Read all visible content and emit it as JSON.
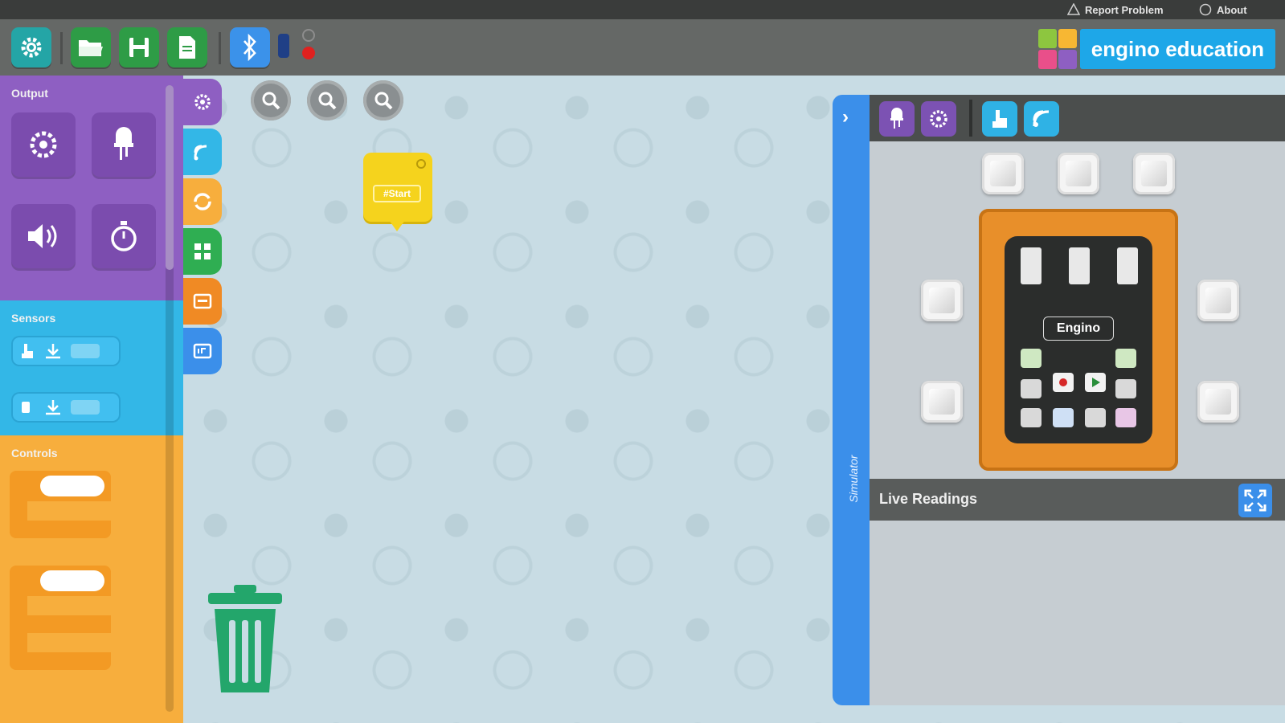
{
  "topbar": {
    "report_problem": "Report Problem",
    "about": "About"
  },
  "toolbar": {
    "buttons": [
      "gear-icon",
      "folder-open-icon",
      "save-icon",
      "new-file-icon",
      "bluetooth-icon"
    ],
    "brand": "engino education"
  },
  "palette": {
    "output_title": "Output",
    "sensors_title": "Sensors",
    "controls_title": "Controls"
  },
  "start_block": {
    "label": "#Start"
  },
  "simulator": {
    "tab_label": "Simulator",
    "board_label": "Engino",
    "live_readings": "Live Readings"
  },
  "colors": {
    "output": "#8e5fc2",
    "sensors": "#33b7e7",
    "controls": "#f7ae3d",
    "accent_blue": "#3b8fea",
    "trash": "#23a66b"
  }
}
